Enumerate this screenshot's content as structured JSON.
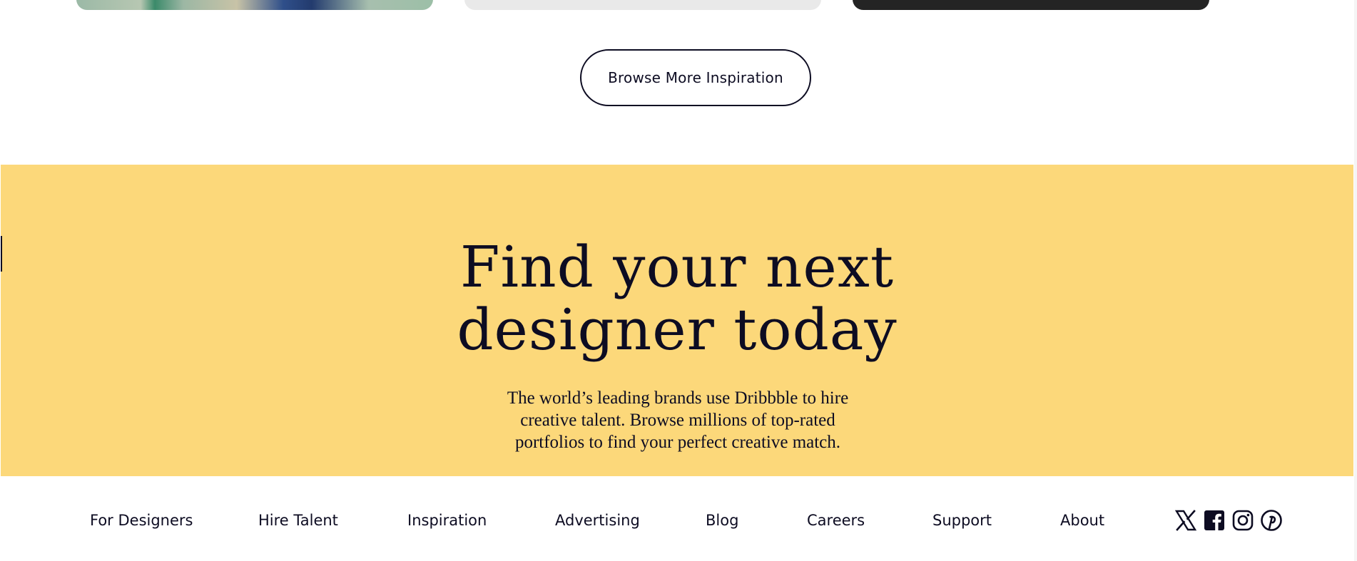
{
  "browse": {
    "label": "Browse More Inspiration"
  },
  "hero": {
    "title_line1": "Find your next",
    "title_line2": "designer today",
    "subtitle_line1": "The world’s leading brands use Dribbble to hire",
    "subtitle_line2": "creative talent. Browse millions of top-rated",
    "subtitle_line3": "portfolios to find your perfect creative match."
  },
  "footer": {
    "links": [
      "For Designers",
      "Hire Talent",
      "Inspiration",
      "Advertising",
      "Blog",
      "Careers",
      "Support",
      "About"
    ],
    "social": [
      "x-icon",
      "facebook-icon",
      "instagram-icon",
      "pinterest-icon"
    ]
  },
  "colors": {
    "hero_background": "#fcd87a",
    "text": "#0d0c22",
    "card_dark": "#242424",
    "card_light": "#e9e9e9"
  }
}
